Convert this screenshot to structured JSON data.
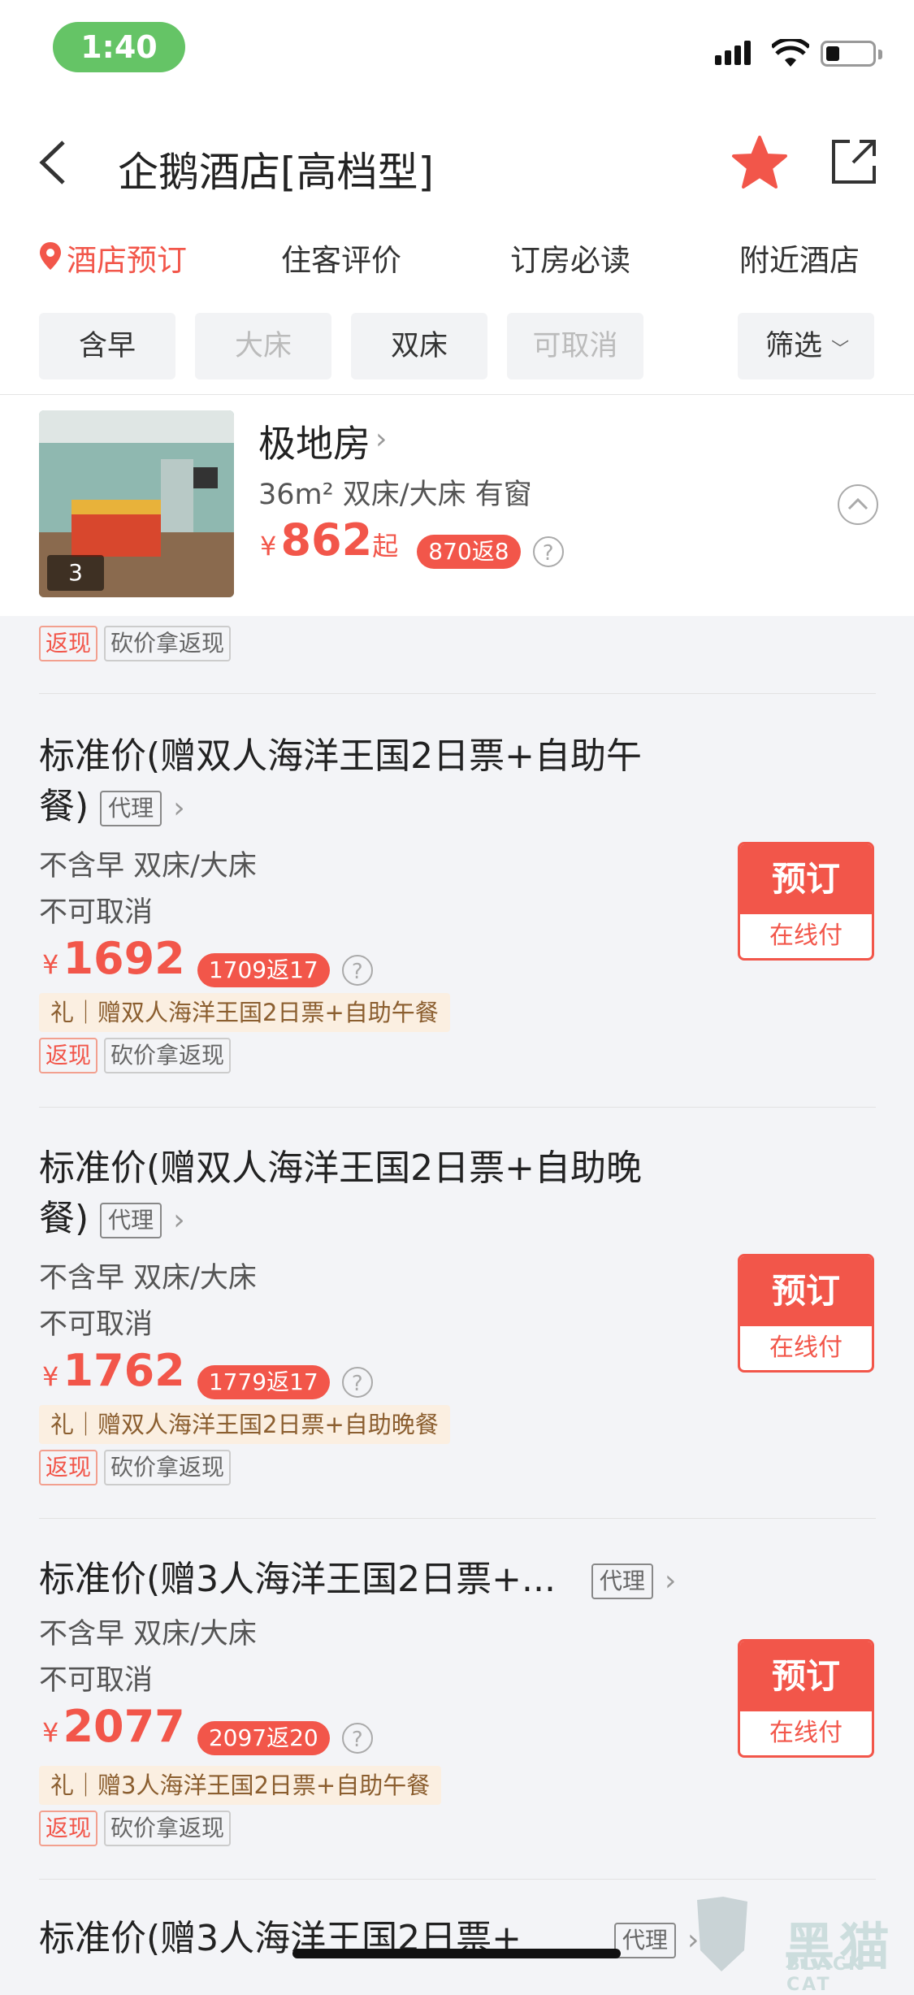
{
  "status_bar": {
    "time": "1:40"
  },
  "header": {
    "title": "企鹅酒店[高档型]"
  },
  "tabs": [
    {
      "label": "酒店预订",
      "active": true
    },
    {
      "label": "住客评价"
    },
    {
      "label": "订房必读"
    },
    {
      "label": "附近酒店"
    }
  ],
  "filters": [
    {
      "label": "含早"
    },
    {
      "label": "大床",
      "disabled": true
    },
    {
      "label": "双床"
    },
    {
      "label": "可取消",
      "disabled": true
    },
    {
      "label": "筛选"
    }
  ],
  "room": {
    "name": "极地房",
    "info": "36m² 双床/大床 有窗",
    "currency": "¥",
    "price": "862",
    "price_suffix": "起",
    "rebate": "870返8",
    "image_count": "3"
  },
  "first_offer_tags": {
    "cash": "返现",
    "bargain": "砍价拿返现"
  },
  "offers": [
    {
      "title_line1": "标准价(赠双人海洋王国2日票+自助午",
      "title_line2": "餐)",
      "agent": "代理",
      "meal_bed": "不含早 双床/大床",
      "cancel": "不可取消",
      "currency": "¥",
      "price": "1692",
      "rebate": "1709返17",
      "gift": "礼｜赠双人海洋王国2日票+自助午餐",
      "cash": "返现",
      "bargain": "砍价拿返现",
      "book": "预订",
      "pay": "在线付"
    },
    {
      "title_line1": "标准价(赠双人海洋王国2日票+自助晚",
      "title_line2": "餐)",
      "agent": "代理",
      "meal_bed": "不含早 双床/大床",
      "cancel": "不可取消",
      "currency": "¥",
      "price": "1762",
      "rebate": "1779返17",
      "gift": "礼｜赠双人海洋王国2日票+自助晚餐",
      "cash": "返现",
      "bargain": "砍价拿返现",
      "book": "预订",
      "pay": "在线付"
    },
    {
      "title_line1": "标准价(赠3人海洋王国2日票+...",
      "agent": "代理",
      "meal_bed": "不含早 双床/大床",
      "cancel": "不可取消",
      "currency": "¥",
      "price": "2077",
      "rebate": "2097返20",
      "gift": "礼｜赠3人海洋王国2日票+自助午餐",
      "cash": "返现",
      "bargain": "砍价拿返现",
      "book": "预订",
      "pay": "在线付"
    },
    {
      "title_line1": "标准价(赠3人海洋王国2日票+",
      "agent": "代理"
    }
  ],
  "watermark": {
    "text": "黑猫",
    "sub": "BLACK CAT"
  }
}
